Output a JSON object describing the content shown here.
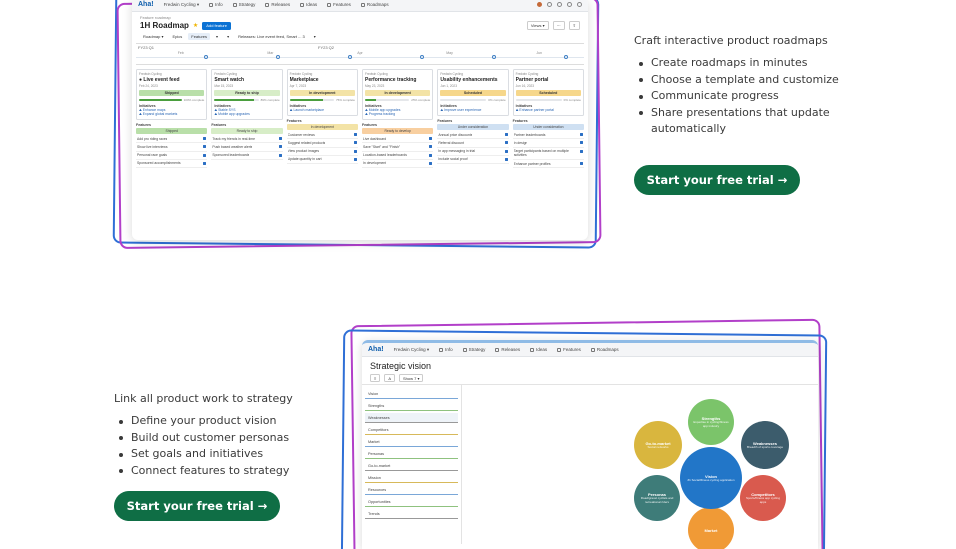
{
  "section1": {
    "title": "Craft interactive product roadmaps",
    "bullets": [
      "Create roadmaps in minutes",
      "Choose a template and customize",
      "Communicate progress",
      "Share presentations that update automatically"
    ],
    "cta": "Start your free trial →"
  },
  "section2": {
    "title": "Link all product work to strategy",
    "bullets": [
      "Define your product vision",
      "Build out customer personas",
      "Set goals and initiatives",
      "Connect features to strategy"
    ],
    "cta": "Start your free trial →"
  },
  "roadmap_app": {
    "logo": "Aha!",
    "nav": [
      "Fredwin Cycling ▾",
      "Info",
      "Strategy",
      "Releases",
      "Ideas",
      "Features",
      "Roadmaps"
    ],
    "breadcrumb": "Feature roadmap",
    "title": "1H Roadmap",
    "add_button": "Add feature",
    "views": "Views ▾",
    "toolbar": [
      "Roadmap ▾",
      "Epics",
      "Features",
      "▾",
      "▾",
      "Releases: Live event feed, Smart ... 3",
      "▾"
    ],
    "quarters": [
      "FY23 Q1",
      "FY23 Q2"
    ],
    "months": [
      "Feb",
      "Mar",
      "Apr",
      "May",
      "Jun"
    ],
    "columns": [
      {
        "product": "Fredwin Cycling",
        "name": "Live event feed",
        "date": "Feb 24, 2023",
        "status": "Shipped",
        "status_color": "#b9dfa9",
        "progress": "100% complete",
        "pct": 100,
        "initiatives": [
          "Enhance maps",
          "Expand global markets"
        ],
        "feature_status": "Shipped",
        "feature_status_color": "#b9dfa9",
        "features": [
          "Add pro riding races",
          "Show live interviews",
          "Personal race goals",
          "Sponsored accomplishments"
        ]
      },
      {
        "product": "Fredwin Cycling",
        "name": "Smart watch",
        "date": "Mar 15, 2023",
        "status": "Ready to ship",
        "status_color": "#d7edc7",
        "progress": "89% complete",
        "pct": 89,
        "initiatives": [
          "Stable SYS",
          "Mobile app upgrades"
        ],
        "feature_status": "Ready to ship",
        "feature_status_color": "#d7edc7",
        "features": [
          "Track my friends in real-time",
          "Push based weather alerts",
          "Sponsored leaderboards"
        ]
      },
      {
        "product": "Fredwin Cycling",
        "name": "Marketplace",
        "date": "Apr 7, 2023",
        "status": "In development",
        "status_color": "#f3e3a6",
        "progress": "75% complete",
        "pct": 75,
        "initiatives": [
          "Launch marketplace"
        ],
        "feature_status": "In development",
        "feature_status_color": "#f3e3a6",
        "features": [
          "Customer reviews",
          "Suggest related products",
          "View product images",
          "Update quantity in cart"
        ]
      },
      {
        "product": "Fredwin Cycling",
        "name": "Performance tracking",
        "date": "May 23, 2023",
        "status": "In development",
        "status_color": "#f3e3a6",
        "progress": "25% complete",
        "pct": 25,
        "initiatives": [
          "Mobile app upgrades",
          "Progress tracking"
        ],
        "feature_status": "Ready to develop",
        "feature_status_color": "#f8cfa0",
        "features": [
          "Live dashboard",
          "Save \"Start\" and \"Finish\"",
          "Location-based leaderboards",
          "In development"
        ]
      },
      {
        "product": "Fredwin Cycling",
        "name": "Usability enhancements",
        "date": "Jun 1, 2023",
        "status": "Scheduled",
        "status_color": "#f6d78b",
        "progress": "0% complete",
        "pct": 0,
        "initiatives": [
          "Improve user experience"
        ],
        "feature_status": "Under consideration",
        "feature_status_color": "#cfe0f2",
        "features": [
          "Annual price discounts",
          "Referral discount",
          "In app messaging in trial",
          "Include social proof"
        ]
      },
      {
        "product": "Fredwin Cycling",
        "name": "Partner portal",
        "date": "Jun 16, 2023",
        "status": "Scheduled",
        "status_color": "#f6d78b",
        "progress": "0% complete",
        "pct": 0,
        "initiatives": [
          "Enhance partner portal"
        ],
        "feature_status": "Under consideration",
        "feature_status_color": "#cfe0f2",
        "features": [
          "Partner leaderboards",
          "In design",
          "Target participants based on multiple activities",
          "Enhance partner profiles"
        ]
      }
    ]
  },
  "strategy_app": {
    "logo": "Aha!",
    "nav": [
      "Fredwin Cycling ▾",
      "Info",
      "Strategy",
      "Releases",
      "Ideas",
      "Features",
      "Roadmaps"
    ],
    "title": "Strategic vision",
    "tools": [
      "≡",
      "A",
      "Show 7 ▾"
    ],
    "list": [
      "Vision",
      "Strengths",
      "Weaknesses",
      "Competitors",
      "Market",
      "Personas",
      "Go-to-market",
      "Mission",
      "Resources",
      "Opportunities",
      "Trends"
    ],
    "bubbles": [
      {
        "title": "Strengths",
        "desc": "Expertise in cycling/fitness app industry",
        "color": "#7bc46a"
      },
      {
        "title": "Weaknesses",
        "desc": "Breadth of sports coverage",
        "color": "#3c5c6c"
      },
      {
        "title": "Competitors",
        "desc": "Sports/fitness app cycling apps",
        "color": "#d95a4e"
      },
      {
        "title": "Market",
        "desc": "",
        "color": "#f09a36"
      },
      {
        "title": "Personas",
        "desc": "Road/gravel cyclists and recreational riders",
        "color": "#3e7c79"
      },
      {
        "title": "Go-to-market",
        "desc": "Social networks",
        "color": "#d9b63e"
      },
      {
        "title": "Vision",
        "desc": "#1 Social/fitness cycling application",
        "color": "#2276c8"
      }
    ]
  }
}
